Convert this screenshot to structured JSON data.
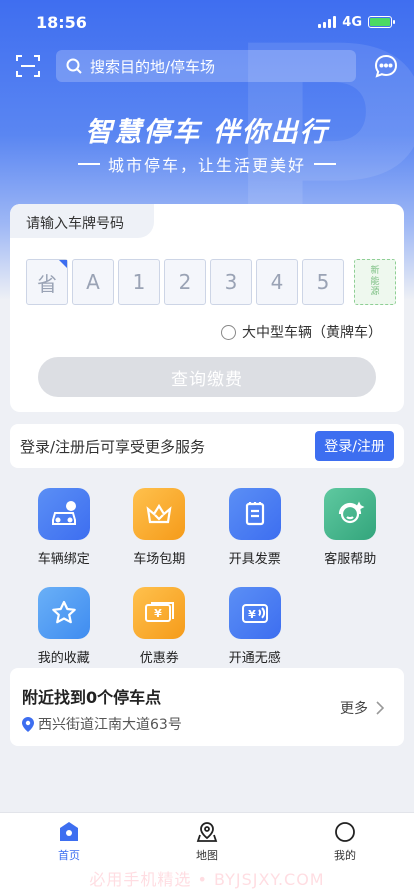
{
  "status": {
    "time": "18:56",
    "network": "4G"
  },
  "search": {
    "placeholder": "搜索目的地/停车场"
  },
  "hero": {
    "title": "智慧停车 伴你出行",
    "subtitle": "城市停车，让生活更美好",
    "bg_letter": "P"
  },
  "plate": {
    "tab_label": "请输入车牌号码",
    "cells": [
      "省",
      "A",
      "1",
      "2",
      "3",
      "4",
      "5"
    ],
    "new_energy_label": "新能源",
    "truck_option": "大中型车辆（黄牌车）",
    "query_button": "查询缴费"
  },
  "login": {
    "prompt": "登录/注册后可享受更多服务",
    "button": "登录/注册"
  },
  "services": [
    {
      "label": "车辆绑定",
      "icon": "car-bind-icon",
      "color": "#4a7df0"
    },
    {
      "label": "车场包期",
      "icon": "crown-icon",
      "color": "#f5a623"
    },
    {
      "label": "开具发票",
      "icon": "invoice-icon",
      "color": "#4a7df0"
    },
    {
      "label": "客服帮助",
      "icon": "headset-icon",
      "color": "#3fb58a"
    },
    {
      "label": "我的收藏",
      "icon": "star-icon",
      "color": "#4a8ff0"
    },
    {
      "label": "优惠券",
      "icon": "coupon-icon",
      "color": "#f5a623"
    },
    {
      "label": "开通无感",
      "icon": "card-icon",
      "color": "#4a7df0"
    }
  ],
  "nearby": {
    "title": "附近找到0个停车点",
    "address": "西兴街道江南大道63号",
    "more": "更多"
  },
  "tabs": [
    {
      "label": "首页",
      "icon": "home-icon",
      "active": true
    },
    {
      "label": "地图",
      "icon": "map-icon",
      "active": false
    },
    {
      "label": "我的",
      "icon": "profile-icon",
      "active": false
    }
  ],
  "watermark": "必用手机精选 • BYJSJXY.COM"
}
